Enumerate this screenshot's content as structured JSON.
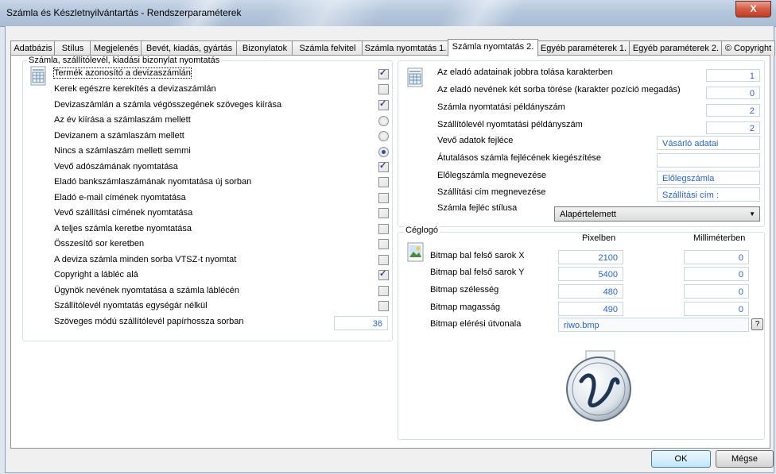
{
  "window": {
    "title": "Számla és Készletnyilvántartás - Rendszerparaméterek",
    "close_glyph": "X"
  },
  "tabs": [
    {
      "label": "Adatbázis"
    },
    {
      "label": "Stílus"
    },
    {
      "label": "Megjelenés"
    },
    {
      "label": "Bevét, kiadás, gyártás"
    },
    {
      "label": "Bizonylatok"
    },
    {
      "label": "Számla felvitel"
    },
    {
      "label": "Számla nyomtatás 1."
    },
    {
      "label": "Számla nyomtatás 2."
    },
    {
      "label": "Egyéb paraméterek 1."
    },
    {
      "label": "Egyéb paraméterek 2."
    },
    {
      "label": "Copyright",
      "icon": "©"
    }
  ],
  "left_group": {
    "title": "Számla, szállítólevél, kiadási bizonylat nyomtatás",
    "rows": [
      {
        "label": "Termék azonosító a devizaszámlán",
        "state": "checked"
      },
      {
        "label": "Kerek egészre kerekítés a devizaszámlán",
        "state": "unchecked"
      },
      {
        "label": "Devizaszámlán a számla végösszegének szöveges kiírása",
        "state": "checked"
      },
      {
        "label": "Az év kiírása a számlaszám mellett",
        "state": "radio-off"
      },
      {
        "label": "Devizanem a számlaszám mellett",
        "state": "radio-off"
      },
      {
        "label": "Nincs a számlaszám mellett semmi",
        "state": "radio-on"
      },
      {
        "label": "Vevő adószámának nyomtatása",
        "state": "checked"
      },
      {
        "label": "Eladó bankszámlaszámának nyomtatása új sorban",
        "state": "unchecked"
      },
      {
        "label": "Eladó e-mail címének nyomtatása",
        "state": "unchecked"
      },
      {
        "label": "Vevő szállítási címének nyomtatása",
        "state": "unchecked"
      },
      {
        "label": "A teljes számla keretbe nyomtatása",
        "state": "unchecked"
      },
      {
        "label": "Összesítő sor keretben",
        "state": "unchecked"
      },
      {
        "label": "A deviza számla minden sorba VTSZ-t nyomtat",
        "state": "unchecked"
      },
      {
        "label": "Copyright a lábléc alá",
        "state": "checked"
      },
      {
        "label": "Ügynök nevének nyomtatása a számla láblécén",
        "state": "unchecked"
      },
      {
        "label": "Szállítólevél nyomtatás egységár nélkül",
        "state": "unchecked"
      }
    ],
    "paper_length_label": "Szöveges módú szállítólevél papírhossza sorban",
    "paper_length_value": "36"
  },
  "right_top": {
    "rows": [
      {
        "label": "Az eladó adatainak jobbra tolása karakterben",
        "value": "1",
        "kind": "num"
      },
      {
        "label": "Az eladó nevének két sorba törése (karakter pozíció megadás)",
        "value": "0",
        "kind": "num"
      },
      {
        "label": "Számla nyomtatási példányszám",
        "value": "2",
        "kind": "num"
      },
      {
        "label": "Szállítólevél nyomtatási példányszám",
        "value": "2",
        "kind": "num"
      },
      {
        "label": "Vevő adatok fejléce",
        "value": "Vásárló adatai",
        "kind": "text"
      },
      {
        "label": "Átutalásos számla fejlécének kiegészítése",
        "value": "",
        "kind": "text"
      },
      {
        "label": "Előlegszámla megnevezése",
        "value": "Előlegszámla",
        "kind": "text"
      },
      {
        "label": "Szállítási cím megnevezése",
        "value": "Szállítási cím :",
        "kind": "text"
      }
    ],
    "style_label": "Számla fejléc stílusa",
    "style_value": "Alapértelemett"
  },
  "logo_group": {
    "title": "Céglogó",
    "col_pixel": "Pixelben",
    "col_mm": "Milliméterben",
    "rows": [
      {
        "label": "Bitmap bal felső sarok X",
        "pixel": "2100",
        "mm": "0"
      },
      {
        "label": "Bitmap bal felső sarok Y",
        "pixel": "5400",
        "mm": "0"
      },
      {
        "label": "Bitmap szélesség",
        "pixel": "480",
        "mm": "0"
      },
      {
        "label": "Bitmap magasság",
        "pixel": "490",
        "mm": "0"
      }
    ],
    "path_label": "Bitmap elérési útvonala",
    "path_value": "riwo.bmp",
    "help_button": "?"
  },
  "buttons": {
    "ok": "OK",
    "cancel": "Mégse"
  },
  "colors": {
    "value_text": "#2c64c4",
    "accent_radio": "#2a4fa3"
  }
}
